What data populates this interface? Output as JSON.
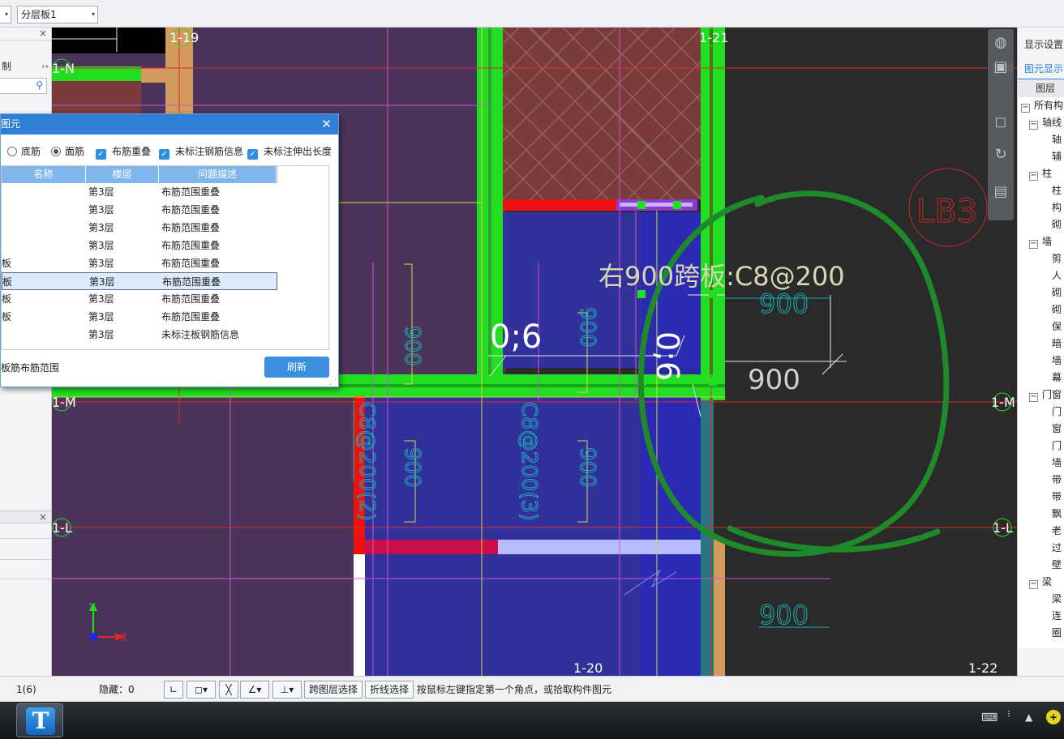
{
  "toolbar": {
    "combo_left_arrow": "▾",
    "layer_select": "分层板1"
  },
  "left_panel": {
    "label_control": "制",
    "collapse_glyph": "››",
    "close_glyph": "×"
  },
  "dialog": {
    "title": "图元",
    "options": [
      {
        "type": "radio",
        "label": "底筋",
        "checked": false
      },
      {
        "type": "radio",
        "label": "面筋",
        "checked": true
      },
      {
        "type": "checkbox",
        "label": "布筋重叠",
        "checked": true
      },
      {
        "type": "checkbox",
        "label": "未标注钢筋信息",
        "checked": true
      },
      {
        "type": "checkbox",
        "label": "未标注伸出长度",
        "checked": true
      }
    ],
    "columns": [
      "名称",
      "楼层",
      "问题描述"
    ],
    "rows": [
      {
        "name": "",
        "floor": "第3层",
        "issue": "布筋范围重叠"
      },
      {
        "name": "",
        "floor": "第3层",
        "issue": "布筋范围重叠"
      },
      {
        "name": "",
        "floor": "第3层",
        "issue": "布筋范围重叠"
      },
      {
        "name": "",
        "floor": "第3层",
        "issue": "布筋范围重叠"
      },
      {
        "name": "板",
        "floor": "第3层",
        "issue": "布筋范围重叠"
      },
      {
        "name": "板",
        "floor": "第3层",
        "issue": "布筋范围重叠"
      },
      {
        "name": "板",
        "floor": "第3层",
        "issue": "布筋范围重叠"
      },
      {
        "name": "板",
        "floor": "第3层",
        "issue": "布筋范围重叠"
      },
      {
        "name": "",
        "floor": "第3层",
        "issue": "未标注板钢筋信息"
      }
    ],
    "selected_row": 5,
    "footnote": "板筋布筋范围",
    "refresh_button": "刷新"
  },
  "drawing": {
    "axes": [
      "1-19",
      "1-21",
      "1-N",
      "1-M",
      "1-L",
      "1-20",
      "1-22"
    ],
    "slab_label": "LB3",
    "rebar_label": "右900跨板:C8@200",
    "dim_900": "900",
    "text_06": "0;6",
    "vertical_labels": [
      "C8@200(2)",
      "C8@200(3)"
    ],
    "axis_x": "X",
    "axis_y": "Y"
  },
  "right_panel": {
    "display_settings": "显示设置",
    "element_display": "图元显示",
    "layer_header": "图层",
    "tree": [
      {
        "level": 0,
        "label": "所有构",
        "expanded": true
      },
      {
        "level": 1,
        "label": "轴线",
        "expanded": true
      },
      {
        "level": 2,
        "label": "轴"
      },
      {
        "level": 2,
        "label": "辅"
      },
      {
        "level": 1,
        "label": "柱",
        "expanded": true
      },
      {
        "level": 2,
        "label": "柱"
      },
      {
        "level": 2,
        "label": "构"
      },
      {
        "level": 2,
        "label": "砌"
      },
      {
        "level": 1,
        "label": "墙",
        "expanded": true
      },
      {
        "level": 2,
        "label": "剪"
      },
      {
        "level": 2,
        "label": "人"
      },
      {
        "level": 2,
        "label": "砌"
      },
      {
        "level": 2,
        "label": "砌"
      },
      {
        "level": 2,
        "label": "保"
      },
      {
        "level": 2,
        "label": "暗"
      },
      {
        "level": 2,
        "label": "墙"
      },
      {
        "level": 2,
        "label": "幕"
      },
      {
        "level": 1,
        "label": "门窗",
        "expanded": true
      },
      {
        "level": 2,
        "label": "门"
      },
      {
        "level": 2,
        "label": "窗"
      },
      {
        "level": 2,
        "label": "门"
      },
      {
        "level": 2,
        "label": "墙"
      },
      {
        "level": 2,
        "label": "带"
      },
      {
        "level": 2,
        "label": "带"
      },
      {
        "level": 2,
        "label": "飘"
      },
      {
        "level": 2,
        "label": "老"
      },
      {
        "level": 2,
        "label": "过"
      },
      {
        "level": 2,
        "label": "壁"
      },
      {
        "level": 1,
        "label": "梁",
        "expanded": true
      },
      {
        "level": 2,
        "label": "梁"
      },
      {
        "level": 2,
        "label": "连"
      },
      {
        "level": 2,
        "label": "圈"
      }
    ]
  },
  "status_bar": {
    "count": "1(6)",
    "hidden": "隐藏：0",
    "cross_layer_select": "跨图层选择",
    "polyline_select": "折线选择",
    "hint": "按鼠标左键指定第一个角点，或拾取构件图元"
  },
  "colors": {
    "accent_blue": "#2f7fd6",
    "green_annotation": "#1f8a2a",
    "wall_green": "#22dd22",
    "slab_purple": "#4a3459",
    "slab_blue": "#32309a",
    "dim_cyan": "#19b0b8"
  }
}
